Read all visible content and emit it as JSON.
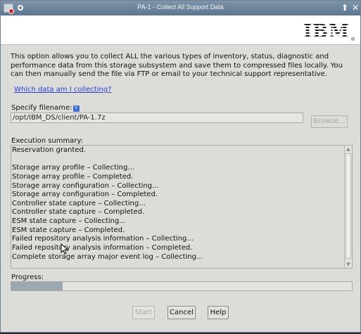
{
  "window": {
    "title": "PA-1 - Collect All Support Data",
    "restore_glyph": "⬆",
    "close_glyph": "✕"
  },
  "header": {
    "logo_text": "IBM",
    "registered_mark": "®"
  },
  "intro": {
    "description": "This option allows you to collect ALL the various types of inventory, status, diagnostic and performance data from this storage subsystem and save them to compressed files locally. You can then manually send the file via FTP or email to your technical support representative.",
    "link": "Which data am I collecting?"
  },
  "file": {
    "label": "Specify filename:",
    "help_glyph": "?",
    "value": "/opt/IBM_DS/client/PA-1.7z",
    "browse_label": "Browse..."
  },
  "execution": {
    "label": "Execution summary:",
    "lines": [
      "Reservation granted.",
      "",
      "Storage array profile – Collecting...",
      "Storage array profile – Completed.",
      "Storage array configuration – Collecting...",
      "Storage array configuration – Completed.",
      "Controller state capture – Collecting...",
      "Controller state capture – Completed.",
      "ESM state capture – Collecting...",
      "ESM state capture – Completed.",
      "Failed repository analysis information – Collecting...",
      "Failed repository analysis information – Completed.",
      "Complete storage array major event log – Collecting..."
    ]
  },
  "progress": {
    "label": "Progress:",
    "fraction": 0.15
  },
  "buttons": {
    "start": "Start",
    "cancel": "Cancel",
    "help": "Help"
  },
  "colors": {
    "titlebar": "#6a8299",
    "link": "#2b3fd0",
    "progress_fill": "#9ca7b4"
  }
}
